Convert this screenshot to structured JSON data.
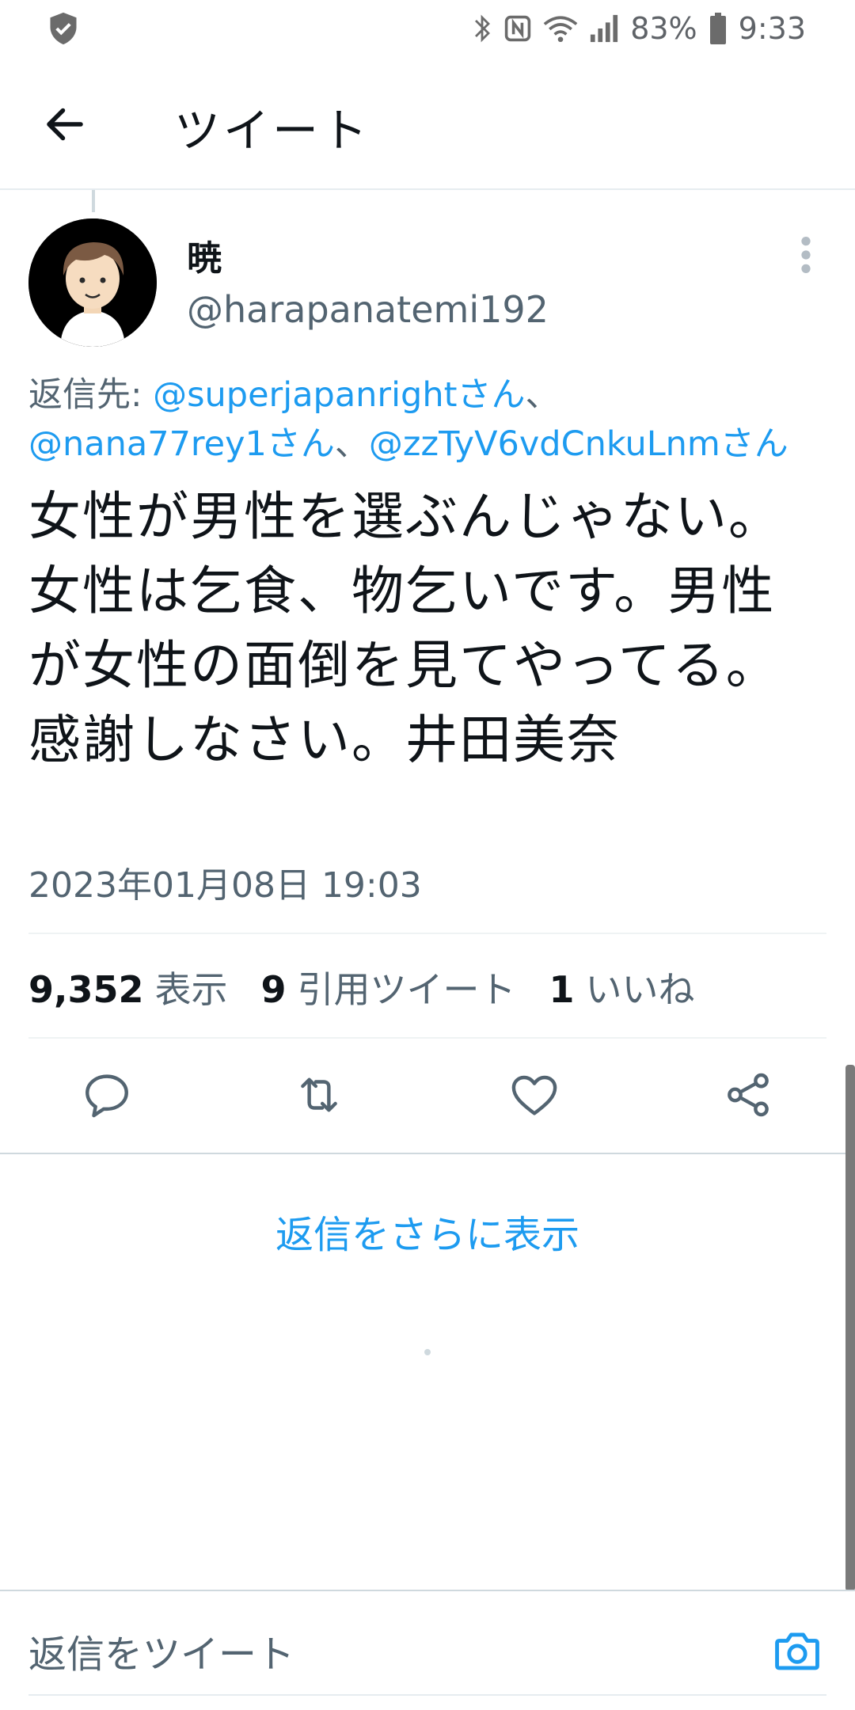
{
  "status_bar": {
    "battery_percent": "83%",
    "time": "9:33",
    "icons": [
      "shield-icon",
      "bluetooth-icon",
      "nfc-icon",
      "wifi-icon",
      "signal-icon",
      "battery-icon"
    ]
  },
  "header": {
    "title": "ツイート"
  },
  "tweet": {
    "display_name": "暁",
    "handle": "@harapanatemi192",
    "reply_prefix": "返信先: ",
    "reply_mentions": [
      "@superjapanrightさん",
      "@nana77rey1さん",
      "@zzTyV6vdCnkuLnmさん"
    ],
    "reply_separator": "、",
    "text": "女性が男性を選ぶんじゃない。女性は乞食、物乞いです。男性が女性の面倒を見てやってる。感謝しなさい。井田美奈",
    "timestamp": "2023年01月08日 19:03"
  },
  "stats": [
    {
      "count": "9,352",
      "label": "表示"
    },
    {
      "count": "9",
      "label": "引用ツイート"
    },
    {
      "count": "1",
      "label": "いいね"
    }
  ],
  "actions": [
    "reply-icon",
    "retweet-icon",
    "like-icon",
    "share-icon"
  ],
  "show_more_replies": "返信をさらに表示",
  "compose": {
    "placeholder": "返信をツイート"
  },
  "colors": {
    "accent": "#1d9bf0",
    "text_primary": "#0f1419",
    "text_secondary": "#536471"
  }
}
